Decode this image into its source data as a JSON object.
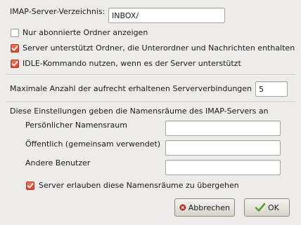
{
  "server_directory": {
    "label": "IMAP-Server-Verzeichnis:",
    "value": "INBOX/"
  },
  "options": {
    "subscribed_only": {
      "label": "Nur abonnierte Ordner anzeigen",
      "checked": false
    },
    "folders_with_subfolders": {
      "label": "Server unterstützt Ordner, die Unterordner und Nachrichten enthalten",
      "checked": true
    },
    "idle_command": {
      "label": "IDLE-Kommando nutzen, wenn es der Server unterstützt",
      "checked": true
    }
  },
  "max_connections": {
    "label": "Maximale Anzahl der aufrecht erhaltenen Serververbindungen",
    "value": "5"
  },
  "namespaces": {
    "intro": "Diese Einstellungen geben die Namensräume des IMAP-Servers an",
    "personal_label": "Persönlicher Namensraum",
    "personal_value": "",
    "public_label": "Öffentlich (gemeinsam verwendet)",
    "public_value": "",
    "other_users_label": "Andere Benutzer",
    "other_users_value": "",
    "override": {
      "label": "Server erlauben diese Namensräume zu übergehen",
      "checked": true
    }
  },
  "buttons": {
    "cancel": "Abbrechen",
    "ok": "OK"
  },
  "colors": {
    "checkbox_on": "#d9472a",
    "background": "#edeceb",
    "cancel_icon": "#c6271b",
    "ok_icon": "#5aa02c"
  },
  "icons": {
    "cancel": "cancel-icon",
    "ok": "checkmark-icon"
  }
}
